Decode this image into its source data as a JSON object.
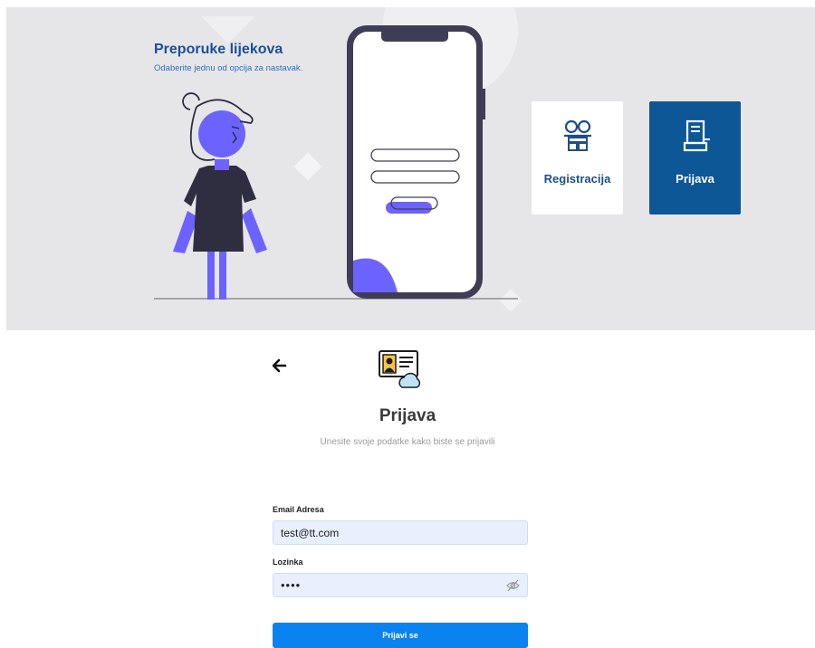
{
  "hero": {
    "title": "Preporuke lijekova",
    "subtitle": "Odaberite jednu od opcija za nastavak.",
    "options": [
      {
        "label": "Registracija",
        "icon": "glasses-books-icon"
      },
      {
        "label": "Prijava",
        "icon": "login-document-icon"
      }
    ]
  },
  "login": {
    "back_icon": "arrow-left-icon",
    "header_icon": "id-card-cloud-icon",
    "title": "Prijava",
    "subtitle": "Unesite svoje podatke kako biste se prijavili",
    "email": {
      "label": "Email Adresa",
      "value": "test@tt.com"
    },
    "password": {
      "label": "Lozinka",
      "value": "••••",
      "toggle_icon": "eye-slash-icon"
    },
    "submit_label": "Prijavi se"
  },
  "colors": {
    "hero_bg": "#e6e6e8",
    "primary_dark": "#0d5797",
    "primary": "#0a82f0",
    "accent_purple": "#6c63ff",
    "input_bg": "#e8f0fe"
  }
}
